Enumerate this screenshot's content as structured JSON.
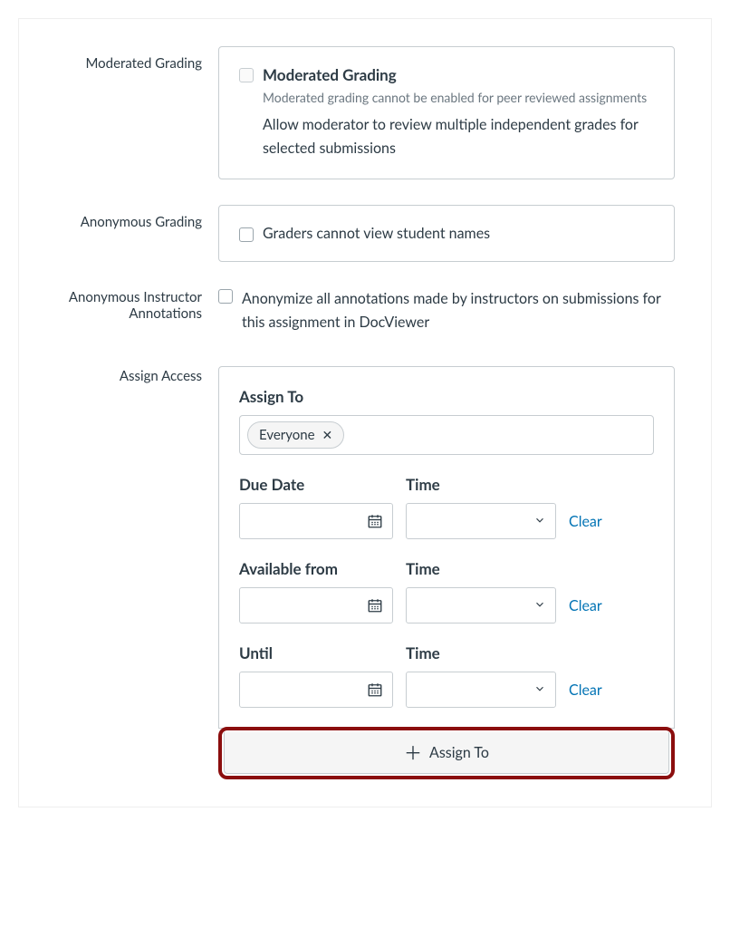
{
  "sections": {
    "moderated": {
      "label": "Moderated Grading",
      "checkbox_title": "Moderated Grading",
      "disabled_note": "Moderated grading cannot be enabled for peer reviewed assignments",
      "description": "Allow moderator to review multiple independent grades for selected submissions"
    },
    "anonymous_grading": {
      "label": "Anonymous Grading",
      "checkbox_label": "Graders cannot view student names"
    },
    "anon_instructor": {
      "label": "Anonymous Instructor Annotations",
      "checkbox_label": "Anonymize all annotations made by instructors on submissions for this assignment in DocViewer"
    },
    "assign": {
      "label": "Assign Access",
      "assign_to_label": "Assign To",
      "token": "Everyone",
      "due_date_label": "Due Date",
      "time_label": "Time",
      "available_from_label": "Available from",
      "until_label": "Until",
      "clear_label": "Clear",
      "add_button_label": "Assign To"
    }
  }
}
